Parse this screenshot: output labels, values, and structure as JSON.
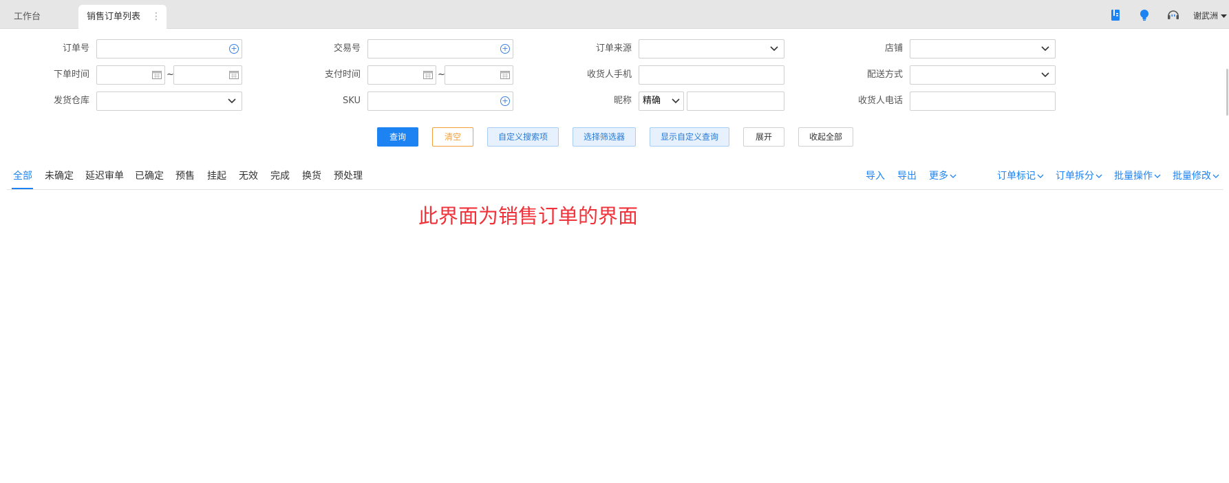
{
  "tabs": [
    {
      "label": "工作台",
      "active": false
    },
    {
      "label": "销售订单列表",
      "active": true
    }
  ],
  "user": {
    "name": "谢武洲"
  },
  "form": {
    "order_no": {
      "label": "订单号"
    },
    "trade_no": {
      "label": "交易号"
    },
    "order_source": {
      "label": "订单来源"
    },
    "shop": {
      "label": "店铺"
    },
    "order_time": {
      "label": "下单时间",
      "separator": "~"
    },
    "pay_time": {
      "label": "支付时间",
      "separator": "~"
    },
    "receiver_mobile": {
      "label": "收货人手机"
    },
    "delivery_method": {
      "label": "配送方式"
    },
    "warehouse": {
      "label": "发货仓库"
    },
    "sku": {
      "label": "SKU"
    },
    "nickname": {
      "label": "昵称",
      "match_mode": "精确"
    },
    "receiver_phone": {
      "label": "收货人电话"
    }
  },
  "buttons": {
    "query": "查询",
    "clear": "清空",
    "custom_search": "自定义搜索项",
    "choose_filter": "选择筛选器",
    "show_custom_query": "显示自定义查询",
    "expand": "展开",
    "collapse_all": "收起全部"
  },
  "status_tabs": [
    {
      "label": "全部",
      "active": true
    },
    {
      "label": "未确定"
    },
    {
      "label": "延迟审单"
    },
    {
      "label": "已确定"
    },
    {
      "label": "预售"
    },
    {
      "label": "挂起"
    },
    {
      "label": "无效"
    },
    {
      "label": "完成"
    },
    {
      "label": "换货"
    },
    {
      "label": "预处理"
    }
  ],
  "actions": {
    "import": "导入",
    "export": "导出",
    "more": "更多",
    "order_mark": "订单标记",
    "order_split": "订单拆分",
    "batch_ops": "批量操作",
    "batch_edit": "批量修改"
  },
  "notice": "此界面为销售订单的界面",
  "colors": {
    "primary": "#1d83f2",
    "warn": "#f2a03c",
    "notice": "#f0333b"
  }
}
